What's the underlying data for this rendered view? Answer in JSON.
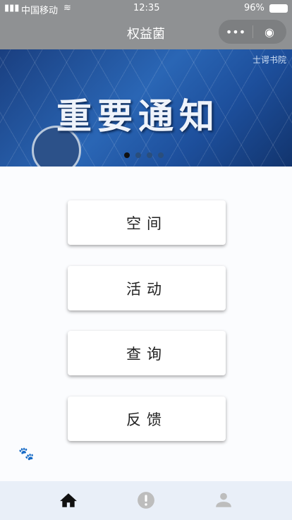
{
  "status": {
    "carrier": "中国移动",
    "time": "12:35",
    "battery": "96%"
  },
  "nav": {
    "title": "权益菌",
    "more_icon": "•••",
    "target_icon": "◉"
  },
  "banner": {
    "headline": "重要通知",
    "logo_text": "士谔书院",
    "slide_count": 4,
    "active_slide": 1
  },
  "buttons": [
    {
      "label": "空间"
    },
    {
      "label": "活动"
    },
    {
      "label": "查询"
    },
    {
      "label": "反馈"
    }
  ],
  "tabbar": {
    "items": [
      {
        "icon": "home-icon",
        "active": true
      },
      {
        "icon": "alert-icon",
        "active": false
      },
      {
        "icon": "user-icon",
        "active": false
      }
    ]
  },
  "colors": {
    "navbar": "#8f9193",
    "tabbar": "#e9eff8",
    "active": "#111111",
    "inactive": "#bdbdbd"
  }
}
